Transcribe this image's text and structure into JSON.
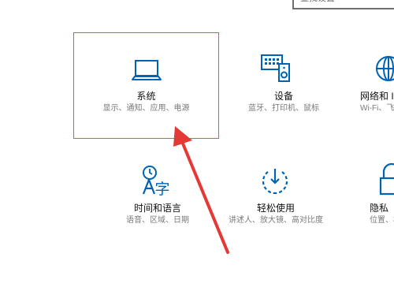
{
  "search": {
    "placeholder": "查找设置"
  },
  "tiles": [
    {
      "title": "系统",
      "desc": "显示、通知、应用、电源"
    },
    {
      "title": "设备",
      "desc": "蓝牙、打印机、鼠标"
    },
    {
      "title": "网络和 Ir",
      "desc": "Wi-Fi、飞行"
    },
    {
      "title": "时间和语言",
      "desc": "语音、区域、日期"
    },
    {
      "title": "轻松使用",
      "desc": "讲述人、放大镜、高对比度"
    },
    {
      "title": "隐私",
      "desc": "位置、相"
    }
  ],
  "icons": [
    "laptop-icon",
    "devices-icon",
    "globe-icon",
    "time-language-icon",
    "ease-of-access-icon",
    "lock-icon"
  ],
  "colors": {
    "accent": "#0063b1",
    "annotation": "#e53935"
  }
}
